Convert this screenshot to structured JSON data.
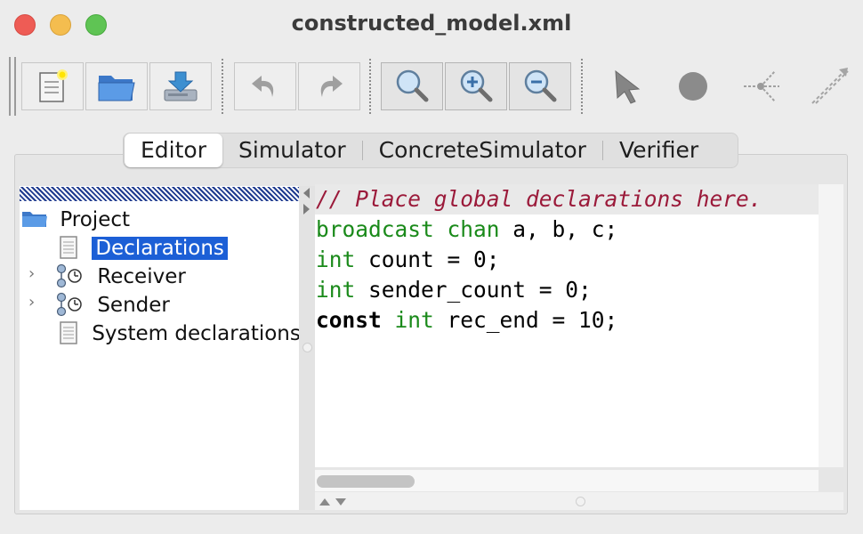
{
  "window": {
    "title": "constructed_model.xml"
  },
  "toolbar": {
    "buttons": [
      {
        "name": "new-document",
        "label": ""
      },
      {
        "name": "open-folder",
        "label": ""
      },
      {
        "name": "save-download",
        "label": ""
      },
      {
        "name": "undo",
        "label": ""
      },
      {
        "name": "redo",
        "label": ""
      },
      {
        "name": "zoom-fit",
        "label": ""
      },
      {
        "name": "zoom-in",
        "label": ""
      },
      {
        "name": "zoom-out",
        "label": ""
      }
    ],
    "tools": [
      "select-pointer",
      "add-location",
      "add-branchpoint",
      "add-edge"
    ]
  },
  "tabs": [
    "Editor",
    "Simulator",
    "ConcreteSimulator",
    "Verifier"
  ],
  "active_tab": "Editor",
  "tree": {
    "root": "Project",
    "items": [
      {
        "label": "Declarations",
        "selected": true,
        "icon": "document-icon"
      },
      {
        "label": "Receiver",
        "selected": false,
        "icon": "template-icon"
      },
      {
        "label": "Sender",
        "selected": false,
        "icon": "template-icon"
      },
      {
        "label": "System declarations",
        "selected": false,
        "icon": "document-icon"
      }
    ]
  },
  "editor": {
    "lines": [
      {
        "comment": "// Place global declarations here."
      },
      {
        "kw1": "broadcast",
        "kw2": "chan",
        "rest": " a, b, c;"
      },
      {
        "kw1": "int",
        "rest": " count = 0;"
      },
      {
        "kw1": "int",
        "rest": " sender_count = 0;"
      },
      {
        "kw1": "const",
        "kw2": "int",
        "rest": " rec_end = 10;"
      }
    ]
  },
  "colors": {
    "comment": "#9b1a3a",
    "keyword": "#1a8a1a",
    "selection": "#1c5fd6",
    "close": "#ee5c55",
    "minimize": "#f4bd4f",
    "maximize": "#5fc454"
  }
}
